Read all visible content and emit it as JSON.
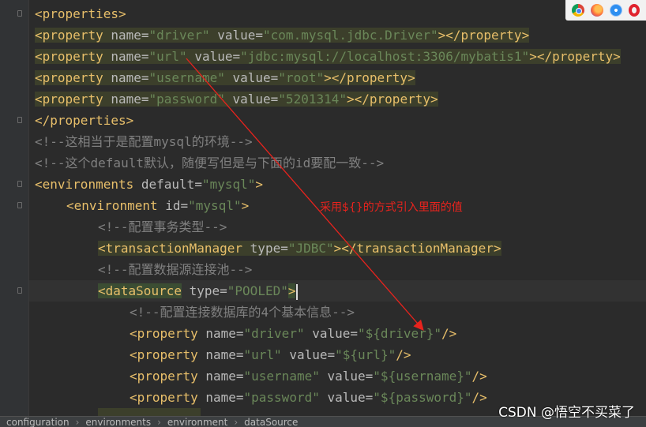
{
  "code": {
    "l1": {
      "open": "<",
      "tag": "properties",
      "close": ">"
    },
    "l2": {
      "open": "<",
      "tag": "property",
      "a1": "name",
      "eq": "=",
      "v1": "\"driver\"",
      "a2": "value",
      "v2": "\"com.mysql.jdbc.Driver\"",
      "mid": "></",
      "etag": "property",
      "close": ">"
    },
    "l3": {
      "open": "<",
      "tag": "property",
      "a1": "name",
      "eq": "=",
      "v1": "\"url\"",
      "a2": "value",
      "v2": "\"jdbc:mysql://localhost:3306/mybatis1\"",
      "mid": "></",
      "etag": "property",
      "close": ">"
    },
    "l4": {
      "open": "<",
      "tag": "property",
      "a1": "name",
      "eq": "=",
      "v1": "\"username\"",
      "a2": "value",
      "v2": "\"root\"",
      "mid": "></",
      "etag": "property",
      "close": ">"
    },
    "l5": {
      "open": "<",
      "tag": "property",
      "a1": "name",
      "eq": "=",
      "v1": "\"password\"",
      "a2": "value",
      "v2": "\"5201314\"",
      "mid": "></",
      "etag": "property",
      "close": ">"
    },
    "l6": {
      "open": "</",
      "tag": "properties",
      "close": ">"
    },
    "l7": {
      "comment": "<!--这相当于是配置mysql的环境-->"
    },
    "l8": {
      "comment": "<!--这个default默认，随便写但是与下面的id要配一致-->"
    },
    "l9": {
      "open": "<",
      "tag": "environments",
      "a1": "default",
      "eq": "=",
      "v1": "\"mysql\"",
      "close": ">"
    },
    "l10": {
      "open": "<",
      "tag": "environment",
      "a1": "id",
      "eq": "=",
      "v1": "\"mysql\"",
      "close": ">"
    },
    "l11": {
      "comment": "<!--配置事务类型-->"
    },
    "l12": {
      "open": "<",
      "tag": "transactionManager",
      "a1": "type",
      "eq": "=",
      "v1": "\"JDBC\"",
      "mid": "></",
      "etag": "transactionManager",
      "close": ">"
    },
    "l13": {
      "comment": "<!--配置数据源连接池-->"
    },
    "l14": {
      "open": "<",
      "tag": "dataSource",
      "a1": "type",
      "eq": "=",
      "v1": "\"POOLED\"",
      "close": ">"
    },
    "l15": {
      "comment": "<!--配置连接数据库的4个基本信息-->"
    },
    "l16": {
      "open": "<",
      "tag": "property",
      "a1": "name",
      "eq": "=",
      "v1": "\"driver\"",
      "a2": "value",
      "v2": "\"${driver}\"",
      "close": "/>"
    },
    "l17": {
      "open": "<",
      "tag": "property",
      "a1": "name",
      "eq": "=",
      "v1": "\"url\"",
      "a2": "value",
      "v2": "\"${url}\"",
      "close": "/>"
    },
    "l18": {
      "open": "<",
      "tag": "property",
      "a1": "name",
      "eq": "=",
      "v1": "\"username\"",
      "a2": "value",
      "v2": "\"${username}\"",
      "close": "/>"
    },
    "l19": {
      "open": "<",
      "tag": "property",
      "a1": "name",
      "eq": "=",
      "v1": "\"password\"",
      "a2": "value",
      "v2": "\"${password}\"",
      "close": "/>"
    }
  },
  "annotation": "采用${}的方式引入里面的值",
  "breadcrumbs": [
    "configuration",
    "environments",
    "environment",
    "dataSource"
  ],
  "watermark": "CSDN @悟空不买菜了",
  "browser_icons": [
    "chrome-icon",
    "firefox-icon",
    "safari-icon",
    "opera-icon"
  ],
  "colors": {
    "background": "#2b2b2b",
    "tag": "#e8bf6a",
    "attribute": "#bababa",
    "string": "#6a8759",
    "comment": "#808080",
    "annotation": "#e8231d"
  }
}
